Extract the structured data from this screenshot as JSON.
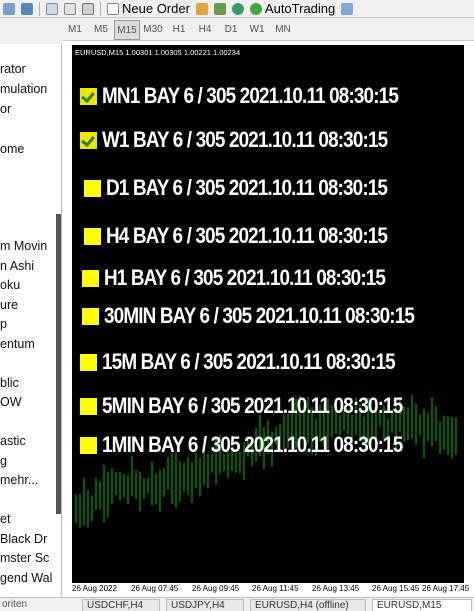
{
  "toolbar": {
    "new_order_label": "Neue Order",
    "autotrading_label": "AutoTrading"
  },
  "timeframes": [
    "M1",
    "M5",
    "M15",
    "M30",
    "H1",
    "H4",
    "D1",
    "W1",
    "MN"
  ],
  "active_timeframe": "M15",
  "navigator": {
    "items": [
      "rator",
      "mulation",
      "or",
      "ome",
      "m Movin",
      "n Ashi",
      "oku",
      "ure",
      "p",
      "entum",
      "blic",
      "OW",
      "astic",
      "g",
      "mehr...",
      "et",
      "Black Dr",
      "mster Sc",
      "gend Wal"
    ]
  },
  "chart": {
    "header": "EURUSD,M15  1.00301 1.00305 1.00221 1.00234",
    "background": "#000000",
    "signals": [
      {
        "label": "MN1 BAY 6 / 305  2021.10.11 08:30:15",
        "marker": "check"
      },
      {
        "label": "W1 BAY 6 / 305  2021.10.11 08:30:15",
        "marker": "check"
      },
      {
        "label": "D1 BAY 6 / 305  2021.10.11 08:30:15",
        "marker": "box"
      },
      {
        "label": "H4 BAY 6 / 305  2021.10.11 08:30:15",
        "marker": "box"
      },
      {
        "label": "H1 BAY 6 / 305  2021.10.11 08:30:15",
        "marker": "box"
      },
      {
        "label": "30MIN BAY 6 / 305  2021.10.11 08:30:15",
        "marker": "box"
      },
      {
        "label": "15M BAY 6 / 305  2021.10.11 08:30:15",
        "marker": "box"
      },
      {
        "label": "5MIN BAY 6 / 305  2021.10.11 08:30:15",
        "marker": "box"
      },
      {
        "label": "1MIN BAY 6 / 305  2021.10.11 08:30:15",
        "marker": "box"
      }
    ],
    "time_labels": [
      "26 Aug 2022",
      "26 Aug 07:45",
      "26 Aug 09:45",
      "26 Aug 11:45",
      "26 Aug 13:45",
      "26 Aug 15:45",
      "26 Aug 17:45"
    ],
    "marker_yellow": "#ffff00",
    "candle_color": "#00c000"
  },
  "bottom": {
    "left_label": "oriten",
    "tabs": [
      "USDCHF,H4",
      "USDJPY,H4",
      "EURUSD,H4 (offline)",
      "EURUSD,M15"
    ]
  }
}
